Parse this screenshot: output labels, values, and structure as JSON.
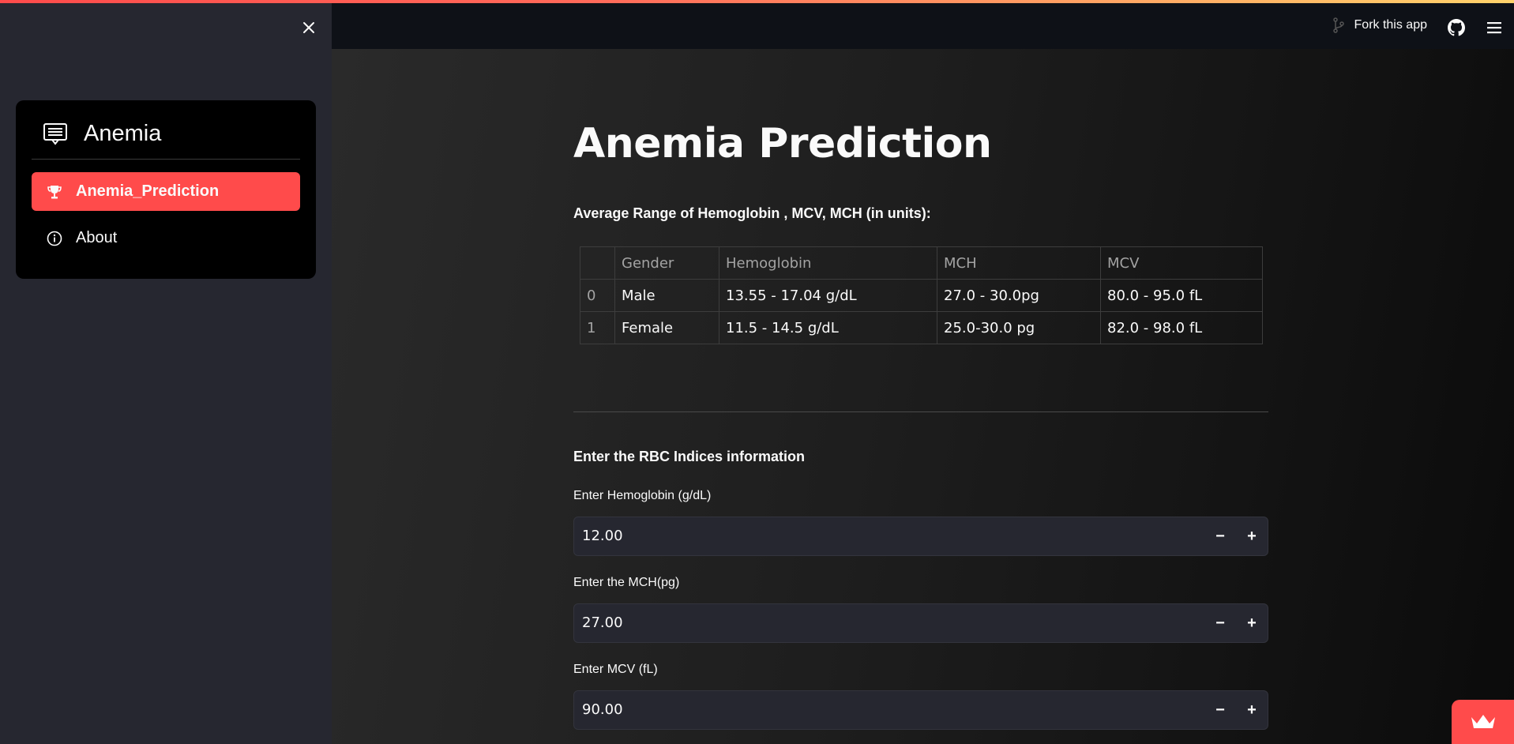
{
  "header": {
    "fork_label": "Fork this app",
    "github_icon": "github-icon",
    "menu_icon": "hamburger-menu-icon"
  },
  "sidebar": {
    "close_icon": "close-icon",
    "menu_title": "Anemia",
    "menu_icon": "newspaper-icon",
    "items": [
      {
        "label": "Anemia_Prediction",
        "icon": "trophy-icon",
        "active": true
      },
      {
        "label": "About",
        "icon": "info-circle-icon",
        "active": false
      }
    ]
  },
  "main": {
    "title": "Anemia Prediction",
    "range_heading": "Average Range of Hemoglobin , MCV, MCH (in units):",
    "table": {
      "columns": [
        "",
        "Gender",
        "Hemoglobin",
        "MCH",
        "MCV"
      ],
      "rows": [
        [
          "0",
          "Male",
          "13.55 - 17.04 g/dL",
          "27.0 - 30.0pg",
          "80.0 - 95.0 fL"
        ],
        [
          "1",
          "Female",
          "11.5 - 14.5 g/dL",
          "25.0-30.0 pg",
          "82.0 - 98.0 fL"
        ]
      ]
    },
    "form_heading": "Enter the RBC Indices information",
    "fields": [
      {
        "label": "Enter Hemoglobin (g/dL)",
        "value": "12.00"
      },
      {
        "label": "Enter the MCH(pg)",
        "value": "27.00"
      },
      {
        "label": "Enter MCV (fL)",
        "value": "90.00"
      }
    ],
    "stepper": {
      "minus": "−",
      "plus": "+"
    }
  },
  "colors": {
    "accent": "#ff4b4b",
    "sidebar_bg": "#262730",
    "header_bg": "#0e1117"
  }
}
